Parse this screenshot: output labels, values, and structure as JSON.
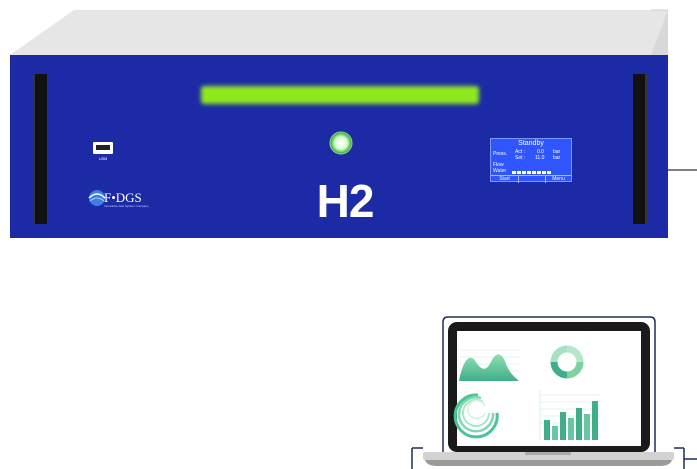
{
  "device": {
    "model_label": "H2",
    "usb_label": "USB",
    "logo_text": "F•DGS",
    "logo_tagline": "Innovative Gas System Company"
  },
  "lcd": {
    "title": "Standby",
    "press_label": "Press.",
    "act_label": "Act :",
    "act_value": "0.0",
    "act_unit": "bar",
    "set_label": "Set :",
    "set_value": "11.0",
    "set_unit": "bar",
    "flow_label": "Flow",
    "water_label": "Water",
    "start_button": "Start",
    "menu_button": "Menu"
  },
  "colors": {
    "panel_blue": "#1c2aa6",
    "status_green": "#8ee81b",
    "lcd_blue": "#2f55ff"
  }
}
